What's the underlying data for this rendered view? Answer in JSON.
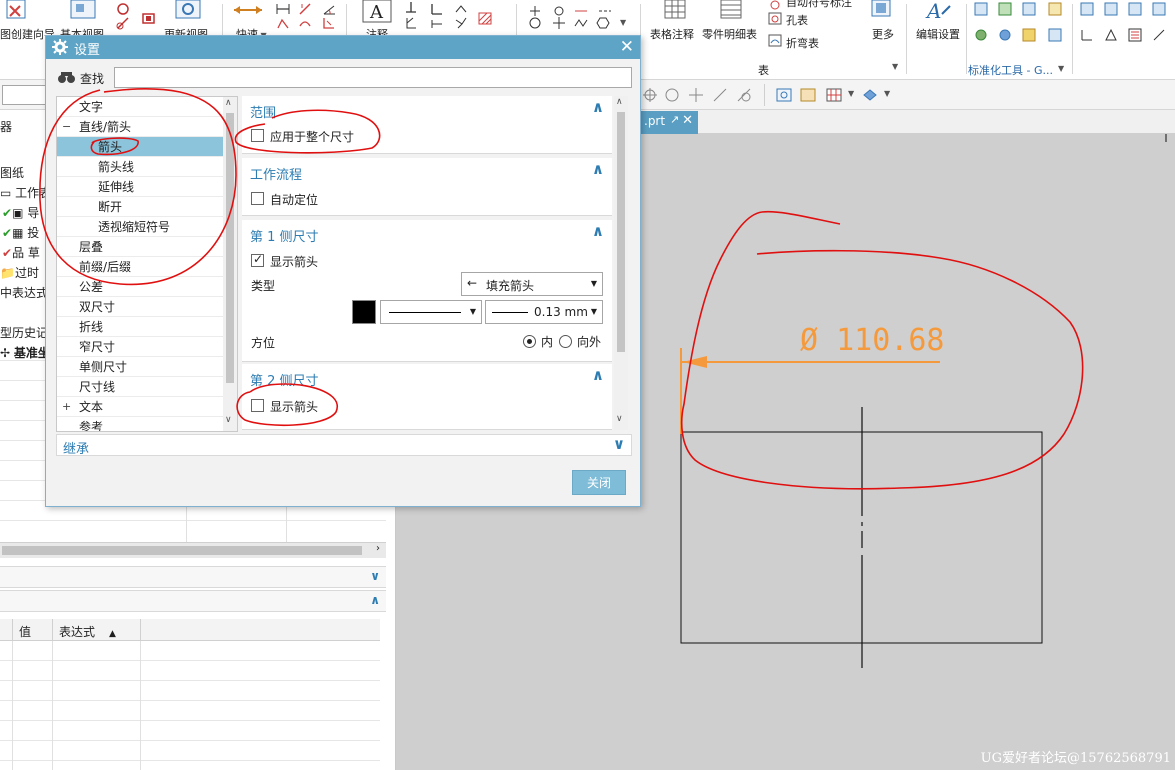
{
  "ribbon": {
    "create_wizard_label": "图创建向导",
    "base_view_label": "基本视图",
    "update_view_label": "更新视图",
    "quick_label": "快速",
    "note_label": "注释",
    "table_note_label": "表格注释",
    "parts_list_label": "零件明细表",
    "auto_balloon_label": "自动符号标注",
    "hole_table_label": "孔表",
    "bend_table_label": "折弯表",
    "more_label": "更多",
    "edit_settings_label": "编辑设置",
    "group_table": "表",
    "group_std_tools": "标准化工具 - G..."
  },
  "graphics": {
    "tab_name": ".prt",
    "dimension_text": "Ø 110.68",
    "watermark": "UG爱好者论坛@15762568791",
    "dimension_color": "#f59a3c",
    "annotation_color": "#e01010"
  },
  "navigator": {
    "col_label": "器",
    "items": [
      "图纸",
      "工作表",
      "导",
      "投",
      "草",
      "过时",
      "中表达式",
      "型历史记录",
      "基准坐"
    ],
    "table_headers": {
      "value": "值",
      "expression": "表达式"
    }
  },
  "dialog": {
    "title": "设置",
    "find_label": "查找",
    "find_value": "",
    "tree": [
      {
        "label": "文字",
        "level": 0,
        "expand": ""
      },
      {
        "label": "直线/箭头",
        "level": 0,
        "expand": "−"
      },
      {
        "label": "箭头",
        "level": 1,
        "expand": "",
        "selected": true
      },
      {
        "label": "箭头线",
        "level": 1,
        "expand": ""
      },
      {
        "label": "延伸线",
        "level": 1,
        "expand": ""
      },
      {
        "label": "断开",
        "level": 1,
        "expand": ""
      },
      {
        "label": "透视缩短符号",
        "level": 1,
        "expand": ""
      },
      {
        "label": "层叠",
        "level": 0,
        "expand": ""
      },
      {
        "label": "前缀/后缀",
        "level": 0,
        "expand": ""
      },
      {
        "label": "公差",
        "level": 0,
        "expand": ""
      },
      {
        "label": "双尺寸",
        "level": 0,
        "expand": ""
      },
      {
        "label": "折线",
        "level": 0,
        "expand": ""
      },
      {
        "label": "窄尺寸",
        "level": 0,
        "expand": ""
      },
      {
        "label": "单侧尺寸",
        "level": 0,
        "expand": ""
      },
      {
        "label": "尺寸线",
        "level": 0,
        "expand": ""
      },
      {
        "label": "文本",
        "level": 0,
        "expand": "+"
      },
      {
        "label": "参考",
        "level": 0,
        "expand": ""
      }
    ],
    "sections": {
      "scope": {
        "title": "范围",
        "apply_whole": "应用于整个尺寸",
        "apply_whole_checked": false
      },
      "workflow": {
        "title": "工作流程",
        "auto_position": "自动定位",
        "auto_position_checked": false
      },
      "side1": {
        "title": "第 1 侧尺寸",
        "show_arrow": "显示箭头",
        "show_arrow_checked": true,
        "type_label": "类型",
        "type_value": "填充箭头",
        "line_width": "0.13 mm",
        "orientation_label": "方位",
        "inner": "内",
        "outer": "向外",
        "inner_selected": true,
        "color": "#000000"
      },
      "side2": {
        "title": "第 2 侧尺寸",
        "show_arrow": "显示箭头",
        "show_arrow_checked": false
      },
      "inherit": {
        "title": "继承"
      }
    },
    "close_button": "关闭"
  }
}
